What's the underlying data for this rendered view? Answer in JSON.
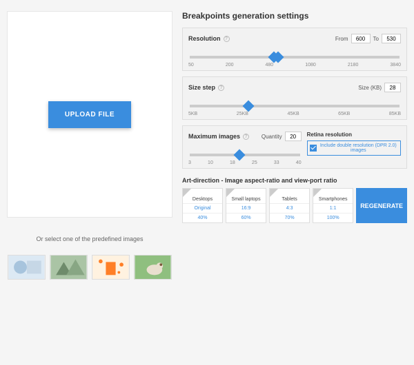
{
  "upload": {
    "button_label": "UPLOAD FILE",
    "predefined_caption": "Or select one of the predefined images"
  },
  "settings_title": "Breakpoints generation settings",
  "resolution": {
    "title": "Resolution",
    "from_label": "From",
    "from_value": "600",
    "to_label": "To",
    "to_value": "530",
    "ticks": [
      "50",
      "200",
      "480",
      "1080",
      "2180",
      "3840"
    ]
  },
  "size_step": {
    "title": "Size step",
    "size_label": "Size (KB)",
    "size_value": "28",
    "ticks": [
      "5KB",
      "25KB",
      "45KB",
      "65KB",
      "85KB"
    ]
  },
  "max_images": {
    "title": "Maximum images",
    "quantity_label": "Quantity",
    "quantity_value": "20",
    "ticks": [
      "3",
      "10",
      "18",
      "25",
      "33",
      "40"
    ],
    "retina_title": "Retina resolution",
    "retina_checkbox_label": "Include double resolution (DPR 2.0) images"
  },
  "art_direction": {
    "title": "Art-direction - Image aspect-ratio and view-port ratio",
    "cards": [
      {
        "label": "Desktops",
        "aspect": "Original",
        "percent": "40%"
      },
      {
        "label": "Small laptops",
        "aspect": "16:9",
        "percent": "60%"
      },
      {
        "label": "Tablets",
        "aspect": "4:3",
        "percent": "70%"
      },
      {
        "label": "Smartphones",
        "aspect": "1:1",
        "percent": "100%"
      }
    ],
    "regenerate_label": "REGENERATE"
  }
}
